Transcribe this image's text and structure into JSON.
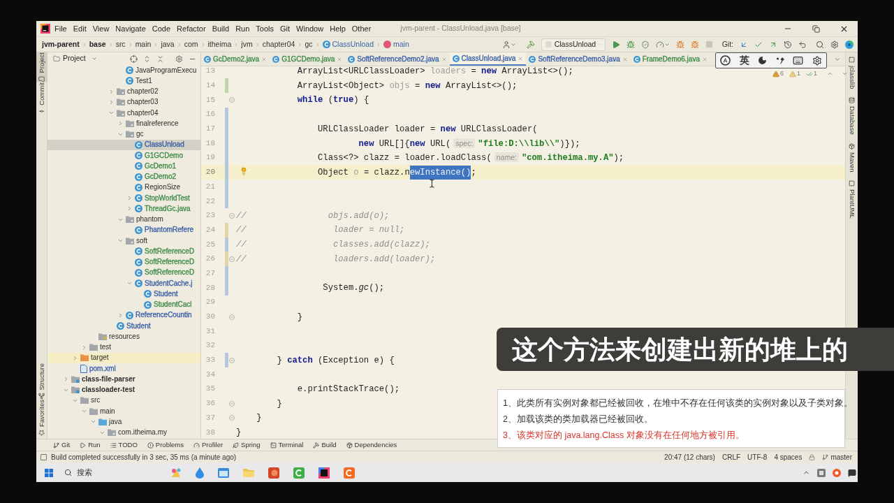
{
  "window": {
    "title": "jvm-parent - ClassUnload.java [base]"
  },
  "menu": [
    "File",
    "Edit",
    "View",
    "Navigate",
    "Code",
    "Refactor",
    "Build",
    "Run",
    "Tools",
    "Git",
    "Window",
    "Help",
    "Other"
  ],
  "breadcrumbs": [
    {
      "label": "jvm-parent",
      "kind": "project"
    },
    {
      "label": "base",
      "kind": "project"
    },
    {
      "label": "src",
      "kind": "folder"
    },
    {
      "label": "main",
      "kind": "folder"
    },
    {
      "label": "java",
      "kind": "folder"
    },
    {
      "label": "com",
      "kind": "folder"
    },
    {
      "label": "itheima",
      "kind": "folder"
    },
    {
      "label": "jvm",
      "kind": "folder"
    },
    {
      "label": "chapter04",
      "kind": "folder"
    },
    {
      "label": "gc",
      "kind": "folder"
    },
    {
      "label": "ClassUnload",
      "kind": "class"
    },
    {
      "label": "main",
      "kind": "method"
    }
  ],
  "toolbar": {
    "run_config": "ClassUnload",
    "git_label": "Git:"
  },
  "left_tool_tabs": {
    "top": [
      {
        "label": "Project",
        "selected": true
      },
      {
        "label": "Commit",
        "selected": false
      }
    ],
    "bottom": [
      {
        "label": "Structure",
        "selected": false
      },
      {
        "label": "Favorites",
        "selected": false
      }
    ]
  },
  "project_panel": {
    "title": "Project",
    "tree": [
      {
        "children": [
          {
            "children": [
              {
                "children": [
                  {
                    "children": [
                      {
                        "children": [
                          {
                            "children": [
                              {
                                "label": "JavaProgramExecu",
                                "kind": "class",
                                "selected": false,
                                "highlighted": false
                              },
                              {
                                "label": "Test1",
                                "kind": "class",
                                "selected": false,
                                "highlighted": false
                              }
                            ]
                          },
                          {
                            "label": "chapter02",
                            "kind": "package",
                            "expanded": false,
                            "selected": false,
                            "highlighted": false
                          },
                          {
                            "label": "chapter03",
                            "kind": "package",
                            "expanded": false,
                            "selected": false,
                            "highlighted": false
                          },
                          {
                            "label": "chapter04",
                            "kind": "package",
                            "expanded": true,
                            "selected": false,
                            "highlighted": false,
                            "children": [
                              {
                                "label": "finalreference",
                                "kind": "package",
                                "expanded": false,
                                "selected": false,
                                "highlighted": false
                              },
                              {
                                "label": "gc",
                                "kind": "package",
                                "expanded": true,
                                "selected": false,
                                "highlighted": false,
                                "children": [
                                  {
                                    "label": "ClassUnload",
                                    "kind": "class",
                                    "color": "#3a5ea8",
                                    "selected": true,
                                    "highlighted": false
                                  },
                                  {
                                    "label": "G1GCDemo",
                                    "kind": "class",
                                    "color": "#3e8b46",
                                    "selected": false,
                                    "highlighted": false
                                  },
                                  {
                                    "label": "GcDemo1",
                                    "kind": "class",
                                    "color": "#3e8b46",
                                    "selected": false,
                                    "highlighted": false
                                  },
                                  {
                                    "label": "GcDemo2",
                                    "kind": "class",
                                    "color": "#3e8b46",
                                    "selected": false,
                                    "highlighted": false
                                  },
                                  {
                                    "label": "RegionSize",
                                    "kind": "class",
                                    "selected": false,
                                    "highlighted": false
                                  },
                                  {
                                    "label": "StopWorldTest",
                                    "kind": "class",
                                    "color": "#3e8b46",
                                    "expanded": false,
                                    "selected": false,
                                    "highlighted": false
                                  },
                                  {
                                    "label": "ThreadGc.java",
                                    "kind": "class",
                                    "color": "#3e8b46",
                                    "expanded": false,
                                    "selected": false,
                                    "highlighted": false
                                  }
                                ]
                              },
                              {
                                "label": "phantom",
                                "kind": "package",
                                "expanded": true,
                                "selected": false,
                                "highlighted": false,
                                "children": [
                                  {
                                    "label": "PhantomRefere",
                                    "kind": "class",
                                    "color": "#3a5ea8",
                                    "selected": false,
                                    "highlighted": false
                                  }
                                ]
                              },
                              {
                                "label": "soft",
                                "kind": "package",
                                "expanded": true,
                                "selected": false,
                                "highlighted": false,
                                "children": [
                                  {
                                    "label": "SoftReferenceD",
                                    "kind": "class",
                                    "color": "#3e8b46",
                                    "selected": false,
                                    "highlighted": false
                                  },
                                  {
                                    "label": "SoftReferenceD",
                                    "kind": "class",
                                    "color": "#3e8b46",
                                    "selected": false,
                                    "highlighted": false
                                  },
                                  {
                                    "label": "SoftReferenceD",
                                    "kind": "class",
                                    "color": "#3e8b46",
                                    "selected": false,
                                    "highlighted": false
                                  },
                                  {
                                    "label": "StudentCache.j",
                                    "kind": "class",
                                    "color": "#3a5ea8",
                                    "expanded": true,
                                    "selected": false,
                                    "highlighted": false,
                                    "children": [
                                      {
                                        "label": "Student",
                                        "kind": "class",
                                        "color": "#3a5ea8",
                                        "selected": false,
                                        "highlighted": false
                                      },
                                      {
                                        "label": "StudentCacl",
                                        "kind": "class",
                                        "color": "#3e8b46",
                                        "selected": false,
                                        "highlighted": false
                                      }
                                    ]
                                  }
                                ]
                              },
                              {
                                "label": "ReferenceCountin",
                                "kind": "class",
                                "color": "#3a5ea8",
                                "expanded": false,
                                "selected": false,
                                "highlighted": false
                              }
                            ]
                          },
                          {
                            "label": "Student",
                            "kind": "class",
                            "color": "#3a5ea8",
                            "selected": false,
                            "highlighted": false
                          }
                        ]
                      }
                    ]
                  },
                  {
                    "label": "resources",
                    "kind": "resources",
                    "selected": false,
                    "highlighted": false
                  }
                ]
              },
              {
                "label": "test",
                "kind": "folder",
                "expanded": false,
                "selected": false,
                "highlighted": false
              }
            ]
          },
          {
            "label": "target",
            "kind": "excluded",
            "expanded": false,
            "selected": false,
            "highlighted": true
          },
          {
            "label": "pom.xml",
            "kind": "maven",
            "color": "#3a5ea8",
            "selected": false,
            "highlighted": false
          }
        ]
      },
      {
        "label": "class-file-parser",
        "kind": "module",
        "expanded": false,
        "selected": false,
        "highlighted": false
      },
      {
        "label": "classloader-test",
        "kind": "module",
        "expanded": true,
        "selected": false,
        "highlighted": false,
        "children": [
          {
            "label": "src",
            "kind": "folder",
            "expanded": true,
            "selected": false,
            "highlighted": false,
            "children": [
              {
                "label": "main",
                "kind": "folder",
                "expanded": true,
                "selected": false,
                "highlighted": false,
                "children": [
                  {
                    "label": "java",
                    "kind": "source",
                    "expanded": true,
                    "selected": false,
                    "highlighted": false,
                    "children": [
                      {
                        "label": "com.itheima.my",
                        "kind": "package",
                        "expanded": true,
                        "selected": false,
                        "highlighted": false
                      }
                    ]
                  }
                ]
              }
            ]
          }
        ]
      }
    ]
  },
  "editor_tabs": [
    {
      "label": "GcDemo2.java",
      "color": "#3e8b46",
      "selected": false
    },
    {
      "label": "G1GCDemo.java",
      "color": "#3e8b46",
      "selected": false
    },
    {
      "label": "SoftReferenceDemo2.java",
      "color": "#3a5ea8",
      "selected": false
    },
    {
      "label": "ClassUnload.java",
      "color": "#3a5ea8",
      "selected": true
    },
    {
      "label": "SoftReferenceDemo3.java",
      "color": "#3a5ea8",
      "selected": false
    },
    {
      "label": "FrameDemo6.java",
      "color": "#3e8b46",
      "selected": false
    }
  ],
  "ime_toolbar": {
    "language": "英"
  },
  "inspections": [
    {
      "kind": "warning",
      "count": "6"
    },
    {
      "kind": "weak_warning",
      "count": "1"
    },
    {
      "kind": "typo",
      "count": "1"
    }
  ],
  "code_lines": [
    {
      "number": "13",
      "tokens": [
        {
          "kind": "plain",
          "text": "            ArrayList<URLClassLoader> "
        },
        {
          "kind": "unused",
          "text": "loaders"
        },
        {
          "kind": "plain",
          "text": " = "
        },
        {
          "kind": "keyword",
          "text": "new"
        },
        {
          "kind": "plain",
          "text": " ArrayList<>();"
        }
      ],
      "current": false,
      "fold": false
    },
    {
      "number": "14",
      "tokens": [
        {
          "kind": "plain",
          "text": "            ArrayList<Object> "
        },
        {
          "kind": "unused",
          "text": "objs"
        },
        {
          "kind": "plain",
          "text": " = "
        },
        {
          "kind": "keyword",
          "text": "new"
        },
        {
          "kind": "plain",
          "text": " ArrayList<>();"
        }
      ],
      "current": false,
      "fold": false,
      "color": "#bcd5a9"
    },
    {
      "number": "15",
      "tokens": [
        {
          "kind": "keyword",
          "text": "            while"
        },
        {
          "kind": "plain",
          "text": " ("
        },
        {
          "kind": "keyword",
          "text": "true"
        },
        {
          "kind": "plain",
          "text": ") {"
        }
      ],
      "current": false,
      "fold": true
    },
    {
      "number": "16",
      "current": false,
      "fold": false,
      "color": "#b3c7dd"
    },
    {
      "number": "17",
      "tokens": [
        {
          "kind": "plain",
          "text": "                URLClassLoader loader = "
        },
        {
          "kind": "keyword",
          "text": "new"
        },
        {
          "kind": "plain",
          "text": " URLClassLoader("
        }
      ],
      "current": false,
      "fold": false,
      "color": "#b3c7dd"
    },
    {
      "number": "18",
      "tokens": [
        {
          "kind": "keyword",
          "text": "                        new"
        },
        {
          "kind": "plain",
          "text": " URL[]{"
        },
        {
          "kind": "keyword",
          "text": "new"
        },
        {
          "kind": "plain",
          "text": " URL("
        },
        {
          "kind": "hint",
          "text": "spec:"
        },
        {
          "kind": "string",
          "text": "\"file:D:\\\\lib\\\\\""
        },
        {
          "kind": "plain",
          "text": ")});"
        }
      ],
      "current": false,
      "fold": false,
      "color": "#b3c7dd"
    },
    {
      "number": "19",
      "tokens": [
        {
          "kind": "plain",
          "text": "                Class<?> clazz = loader.loadClass("
        },
        {
          "kind": "hint",
          "text": "name:"
        },
        {
          "kind": "string",
          "text": "\"com.itheima.my.A\""
        },
        {
          "kind": "plain",
          "text": ");"
        }
      ],
      "current": false,
      "fold": false,
      "color": "#b3c7dd"
    },
    {
      "number": "20",
      "tokens": [
        {
          "kind": "plain",
          "text": "                Object "
        },
        {
          "kind": "unused",
          "text": "o"
        },
        {
          "kind": "plain",
          "text": " = clazz.n"
        },
        {
          "kind": "selected",
          "text": "ewInstance()"
        },
        {
          "kind": "plain",
          "text": ";"
        }
      ],
      "current": true,
      "fold": false,
      "color": "#b3c7dd"
    },
    {
      "number": "21",
      "current": false,
      "fold": false,
      "color": "#b3c7dd"
    },
    {
      "number": "22",
      "current": false,
      "fold": false,
      "color": "#b3c7dd"
    },
    {
      "number": "23",
      "tokens": [
        {
          "kind": "comment",
          "text": "//                objs.add(o);"
        }
      ],
      "current": false,
      "fold": true
    },
    {
      "number": "24",
      "tokens": [
        {
          "kind": "comment",
          "text": "//                 loader = null;"
        }
      ],
      "current": false,
      "fold": false,
      "color": "#e6d3a3"
    },
    {
      "number": "25",
      "tokens": [
        {
          "kind": "comment",
          "text": "//                 classes.add(clazz);"
        }
      ],
      "current": false,
      "fold": false,
      "color": "#b3c7dd"
    },
    {
      "number": "26",
      "tokens": [
        {
          "kind": "comment",
          "text": "//                 loaders.add(loader);"
        }
      ],
      "current": false,
      "fold": true,
      "color": "#e6d3a3"
    },
    {
      "number": "27",
      "current": false,
      "fold": false,
      "color": "#b3c7dd"
    },
    {
      "number": "28",
      "tokens": [
        {
          "kind": "plain",
          "text": "                 System."
        },
        {
          "kind": "static",
          "text": "gc"
        },
        {
          "kind": "plain",
          "text": "();"
        }
      ],
      "current": false,
      "fold": false,
      "color": "#b3c7dd"
    },
    {
      "number": "29",
      "current": false,
      "fold": false
    },
    {
      "number": "30",
      "tokens": [
        {
          "kind": "plain",
          "text": "            }"
        }
      ],
      "current": false,
      "fold": true
    },
    {
      "number": "31",
      "current": false,
      "fold": false
    },
    {
      "number": "32",
      "current": false,
      "fold": false
    },
    {
      "number": "33",
      "tokens": [
        {
          "kind": "plain",
          "text": "        } "
        },
        {
          "kind": "keyword",
          "text": "catch"
        },
        {
          "kind": "plain",
          "text": " (Exception e) {"
        }
      ],
      "current": false,
      "fold": true,
      "color": "#b3c7dd"
    },
    {
      "number": "34",
      "current": false,
      "fold": false
    },
    {
      "number": "35",
      "tokens": [
        {
          "kind": "plain",
          "text": "            e.printStackTrace();"
        }
      ],
      "current": false,
      "fold": false
    },
    {
      "number": "36",
      "tokens": [
        {
          "kind": "plain",
          "text": "        }"
        }
      ],
      "current": false,
      "fold": true
    },
    {
      "number": "37",
      "tokens": [
        {
          "kind": "plain",
          "text": "    }"
        }
      ],
      "current": false,
      "fold": true
    },
    {
      "number": "38",
      "tokens": [
        {
          "kind": "plain",
          "text": "}"
        }
      ],
      "current": false,
      "fold": false
    }
  ],
  "right_tool_tabs": [
    "jclasslib",
    "Database",
    "Maven",
    "PlantUML"
  ],
  "tool_windows": [
    "Git",
    "Run",
    "TODO",
    "Problems",
    "Profiler",
    "Spring",
    "Terminal",
    "Build",
    "Dependencies"
  ],
  "status_bar": {
    "message": "Build completed successfully in 3 sec, 35 ms (a minute ago)",
    "position": "20:47 (12 chars)",
    "line_separator": "CRLF",
    "encoding": "UTF-8",
    "indent": "4 spaces",
    "branch": "master"
  },
  "taskbar": {
    "search_label": "搜索"
  },
  "subtitle": "这个方法来创建出新的堆上的",
  "note_card": {
    "items": [
      {
        "text": "1、此类所有实例对象都已经被回收，在堆中不存在任何该类的实例对象以及子类对象。",
        "color": "#333333"
      },
      {
        "text": "2、加载该类的类加载器已经被回收。",
        "color": "#333333"
      },
      {
        "text": "3、该类对应的 java.lang.Class 对象没有在任何地方被引用。",
        "color": "#d8352a"
      }
    ]
  }
}
